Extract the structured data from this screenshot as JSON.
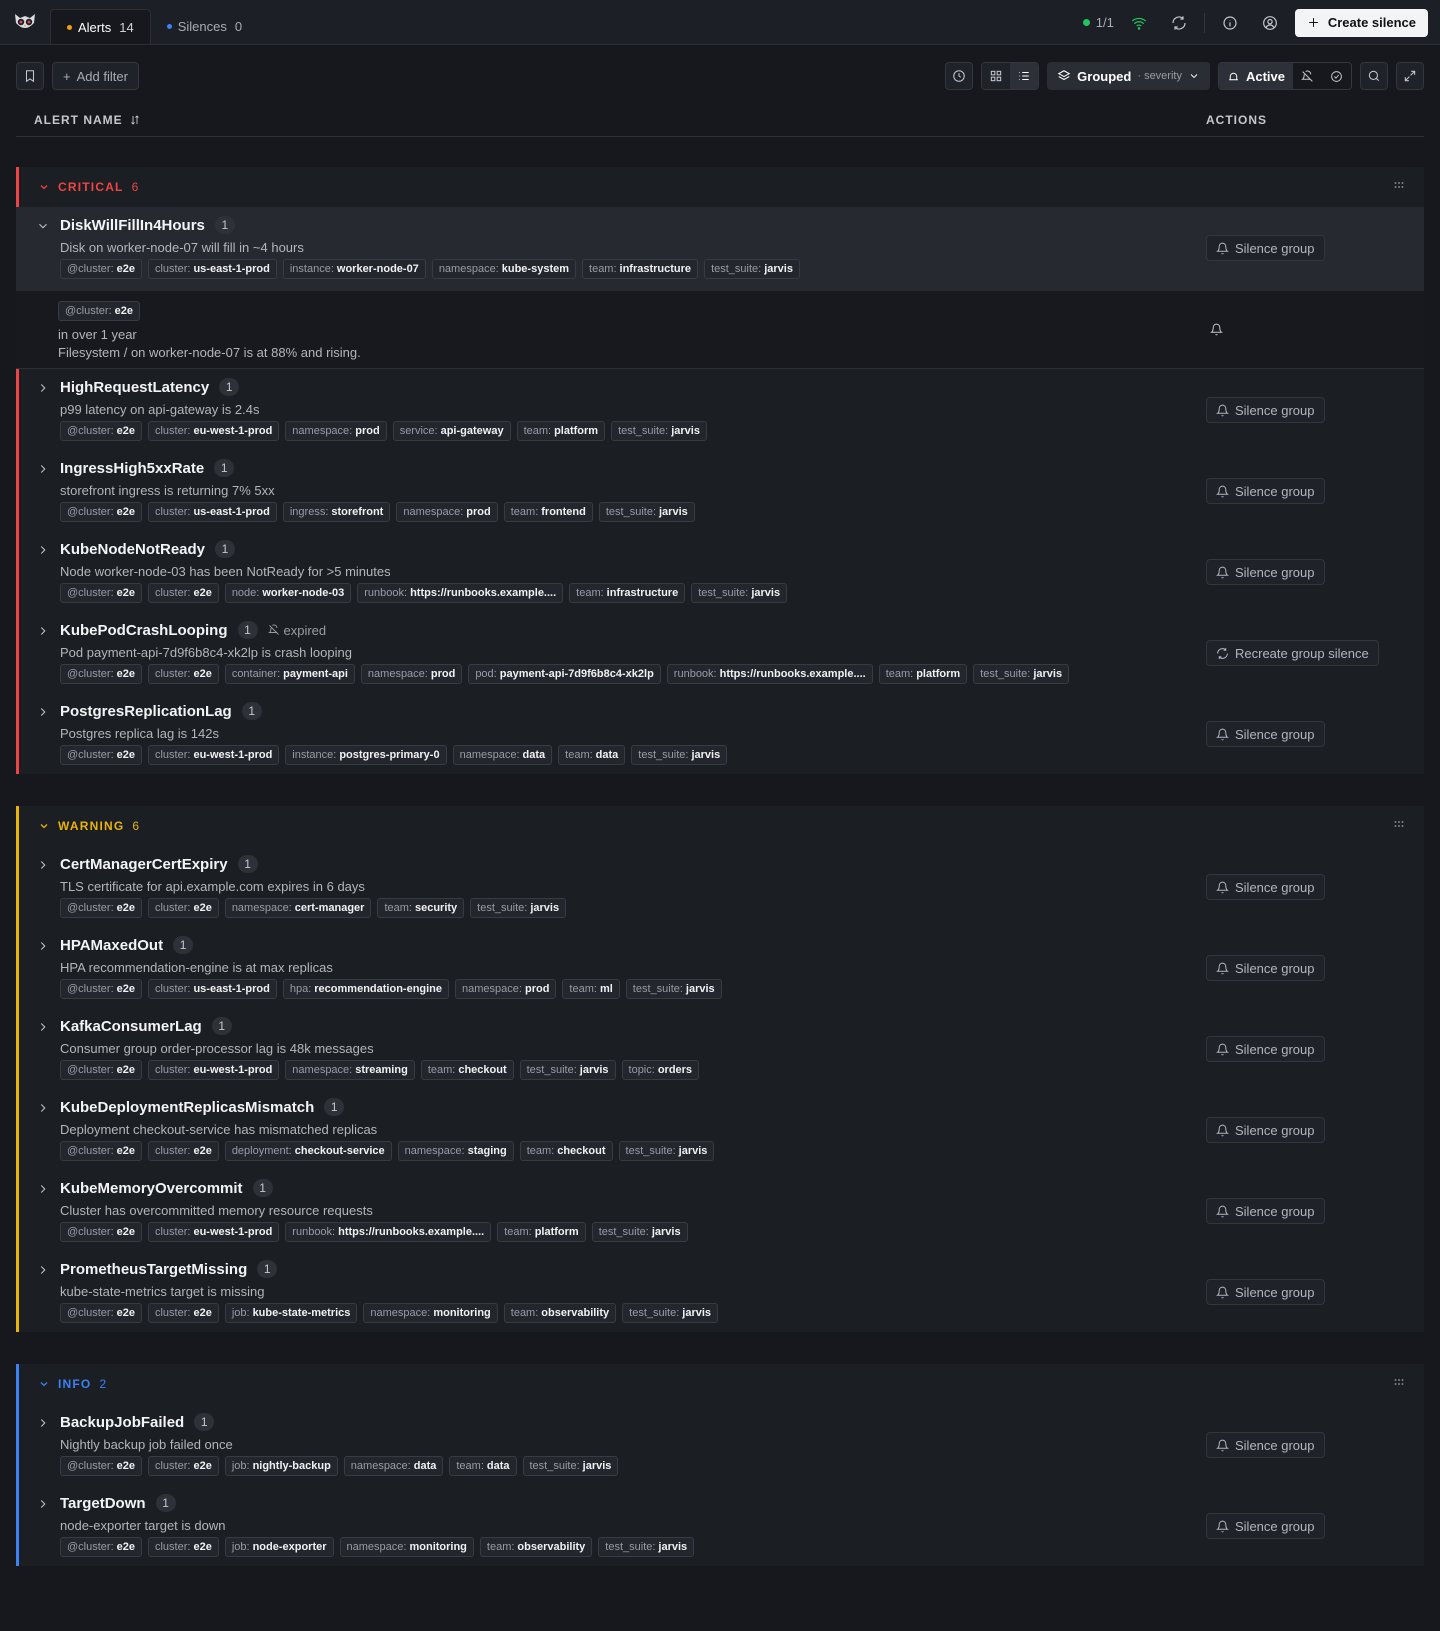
{
  "tabs": [
    {
      "label": "Alerts",
      "count": "14",
      "color": "#f59e0b"
    },
    {
      "label": "Silences",
      "count": "0",
      "color": "#3b82f6"
    }
  ],
  "topbar": {
    "cluster_status": "1/1",
    "create_label": "Create silence"
  },
  "toolbar": {
    "add_filter": "Add filter",
    "grouped": "Grouped",
    "grouped_by": "· severity",
    "state_active": "Active"
  },
  "table": {
    "col_name": "ALERT NAME",
    "col_actions": "ACTIONS"
  },
  "subrow": {
    "label_key": "@cluster:",
    "label_val": "e2e",
    "time": "in over 1 year",
    "summary": "Filesystem / on worker-node-07 is at 88% and rising."
  },
  "groups": [
    {
      "name": "CRITICAL",
      "count": "6",
      "color": "#ef4444",
      "alerts": [
        {
          "name": "DiskWillFillIn4Hours",
          "count": "1",
          "desc": "Disk on worker-node-07 will fill in ~4 hours",
          "action": "Silence group",
          "labels": [
            [
              "@cluster:",
              "e2e"
            ],
            [
              "cluster:",
              "us-east-1-prod"
            ],
            [
              "instance:",
              "worker-node-07"
            ],
            [
              "namespace:",
              "kube-system"
            ],
            [
              "team:",
              "infrastructure"
            ],
            [
              "test_suite:",
              "jarvis"
            ]
          ]
        },
        {
          "name": "HighRequestLatency",
          "count": "1",
          "desc": "p99 latency on api-gateway is 2.4s",
          "action": "Silence group",
          "labels": [
            [
              "@cluster:",
              "e2e"
            ],
            [
              "cluster:",
              "eu-west-1-prod"
            ],
            [
              "namespace:",
              "prod"
            ],
            [
              "service:",
              "api-gateway"
            ],
            [
              "team:",
              "platform"
            ],
            [
              "test_suite:",
              "jarvis"
            ]
          ]
        },
        {
          "name": "IngressHigh5xxRate",
          "count": "1",
          "desc": "storefront ingress is returning 7% 5xx",
          "action": "Silence group",
          "labels": [
            [
              "@cluster:",
              "e2e"
            ],
            [
              "cluster:",
              "us-east-1-prod"
            ],
            [
              "ingress:",
              "storefront"
            ],
            [
              "namespace:",
              "prod"
            ],
            [
              "team:",
              "frontend"
            ],
            [
              "test_suite:",
              "jarvis"
            ]
          ]
        },
        {
          "name": "KubeNodeNotReady",
          "count": "1",
          "desc": "Node worker-node-03 has been NotReady for >5 minutes",
          "action": "Silence group",
          "labels": [
            [
              "@cluster:",
              "e2e"
            ],
            [
              "cluster:",
              "e2e"
            ],
            [
              "node:",
              "worker-node-03"
            ],
            [
              "runbook:",
              "https://runbooks.example...."
            ],
            [
              "team:",
              "infrastructure"
            ],
            [
              "test_suite:",
              "jarvis"
            ]
          ]
        },
        {
          "name": "KubePodCrashLooping",
          "count": "1",
          "expired": "expired",
          "desc": "Pod payment-api-7d9f6b8c4-xk2lp is crash looping",
          "action": "Recreate group silence",
          "labels": [
            [
              "@cluster:",
              "e2e"
            ],
            [
              "cluster:",
              "e2e"
            ],
            [
              "container:",
              "payment-api"
            ],
            [
              "namespace:",
              "prod"
            ],
            [
              "pod:",
              "payment-api-7d9f6b8c4-xk2lp"
            ],
            [
              "runbook:",
              "https://runbooks.example...."
            ],
            [
              "team:",
              "platform"
            ],
            [
              "test_suite:",
              "jarvis"
            ]
          ]
        },
        {
          "name": "PostgresReplicationLag",
          "count": "1",
          "desc": "Postgres replica lag is 142s",
          "action": "Silence group",
          "labels": [
            [
              "@cluster:",
              "e2e"
            ],
            [
              "cluster:",
              "eu-west-1-prod"
            ],
            [
              "instance:",
              "postgres-primary-0"
            ],
            [
              "namespace:",
              "data"
            ],
            [
              "team:",
              "data"
            ],
            [
              "test_suite:",
              "jarvis"
            ]
          ]
        }
      ]
    },
    {
      "name": "WARNING",
      "count": "6",
      "color": "#eab308",
      "alerts": [
        {
          "name": "CertManagerCertExpiry",
          "count": "1",
          "desc": "TLS certificate for api.example.com expires in 6 days",
          "action": "Silence group",
          "labels": [
            [
              "@cluster:",
              "e2e"
            ],
            [
              "cluster:",
              "e2e"
            ],
            [
              "namespace:",
              "cert-manager"
            ],
            [
              "team:",
              "security"
            ],
            [
              "test_suite:",
              "jarvis"
            ]
          ]
        },
        {
          "name": "HPAMaxedOut",
          "count": "1",
          "desc": "HPA recommendation-engine is at max replicas",
          "action": "Silence group",
          "labels": [
            [
              "@cluster:",
              "e2e"
            ],
            [
              "cluster:",
              "us-east-1-prod"
            ],
            [
              "hpa:",
              "recommendation-engine"
            ],
            [
              "namespace:",
              "prod"
            ],
            [
              "team:",
              "ml"
            ],
            [
              "test_suite:",
              "jarvis"
            ]
          ]
        },
        {
          "name": "KafkaConsumerLag",
          "count": "1",
          "desc": "Consumer group order-processor lag is 48k messages",
          "action": "Silence group",
          "labels": [
            [
              "@cluster:",
              "e2e"
            ],
            [
              "cluster:",
              "eu-west-1-prod"
            ],
            [
              "namespace:",
              "streaming"
            ],
            [
              "team:",
              "checkout"
            ],
            [
              "test_suite:",
              "jarvis"
            ],
            [
              "topic:",
              "orders"
            ]
          ]
        },
        {
          "name": "KubeDeploymentReplicasMismatch",
          "count": "1",
          "desc": "Deployment checkout-service has mismatched replicas",
          "action": "Silence group",
          "labels": [
            [
              "@cluster:",
              "e2e"
            ],
            [
              "cluster:",
              "e2e"
            ],
            [
              "deployment:",
              "checkout-service"
            ],
            [
              "namespace:",
              "staging"
            ],
            [
              "team:",
              "checkout"
            ],
            [
              "test_suite:",
              "jarvis"
            ]
          ]
        },
        {
          "name": "KubeMemoryOvercommit",
          "count": "1",
          "desc": "Cluster has overcommitted memory resource requests",
          "action": "Silence group",
          "labels": [
            [
              "@cluster:",
              "e2e"
            ],
            [
              "cluster:",
              "eu-west-1-prod"
            ],
            [
              "runbook:",
              "https://runbooks.example...."
            ],
            [
              "team:",
              "platform"
            ],
            [
              "test_suite:",
              "jarvis"
            ]
          ]
        },
        {
          "name": "PrometheusTargetMissing",
          "count": "1",
          "desc": "kube-state-metrics target is missing",
          "action": "Silence group",
          "labels": [
            [
              "@cluster:",
              "e2e"
            ],
            [
              "cluster:",
              "e2e"
            ],
            [
              "job:",
              "kube-state-metrics"
            ],
            [
              "namespace:",
              "monitoring"
            ],
            [
              "team:",
              "observability"
            ],
            [
              "test_suite:",
              "jarvis"
            ]
          ]
        }
      ]
    },
    {
      "name": "INFO",
      "count": "2",
      "color": "#3b82f6",
      "alerts": [
        {
          "name": "BackupJobFailed",
          "count": "1",
          "desc": "Nightly backup job failed once",
          "action": "Silence group",
          "labels": [
            [
              "@cluster:",
              "e2e"
            ],
            [
              "cluster:",
              "e2e"
            ],
            [
              "job:",
              "nightly-backup"
            ],
            [
              "namespace:",
              "data"
            ],
            [
              "team:",
              "data"
            ],
            [
              "test_suite:",
              "jarvis"
            ]
          ]
        },
        {
          "name": "TargetDown",
          "count": "1",
          "desc": "node-exporter target is down",
          "action": "Silence group",
          "labels": [
            [
              "@cluster:",
              "e2e"
            ],
            [
              "cluster:",
              "e2e"
            ],
            [
              "job:",
              "node-exporter"
            ],
            [
              "namespace:",
              "monitoring"
            ],
            [
              "team:",
              "observability"
            ],
            [
              "test_suite:",
              "jarvis"
            ]
          ]
        }
      ]
    }
  ]
}
